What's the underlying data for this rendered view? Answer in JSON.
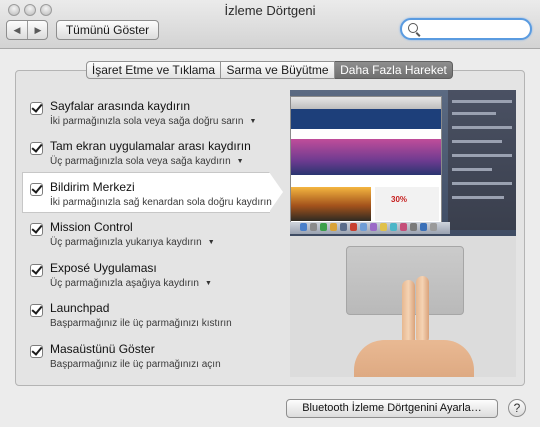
{
  "window": {
    "title": "İzleme Dörtgeni"
  },
  "toolbar": {
    "back_icon": "chevron-left-icon",
    "forward_icon": "chevron-right-icon",
    "show_all_label": "Tümünü Göster",
    "search_value": "",
    "search_icon": "search-icon"
  },
  "tabs": [
    {
      "label": "İşaret Etme ve Tıklama",
      "selected": false
    },
    {
      "label": "Sarma ve Büyütme",
      "selected": false
    },
    {
      "label": "Daha Fazla Hareket",
      "selected": true
    }
  ],
  "gestures": [
    {
      "title": "Sayfalar arasında kaydırın",
      "subtitle": "İki parmağınızla sola veya sağa doğru sarın",
      "has_dropdown": true,
      "checked": true,
      "selected": false
    },
    {
      "title": "Tam ekran uygulamalar arası kaydırın",
      "subtitle": "Üç parmağınızla sola veya sağa kaydırın",
      "has_dropdown": true,
      "checked": true,
      "selected": false
    },
    {
      "title": "Bildirim Merkezi",
      "subtitle": "İki parmağınızla sağ kenardan sola doğru kaydırın",
      "has_dropdown": false,
      "checked": true,
      "selected": true
    },
    {
      "title": "Mission Control",
      "subtitle": "Üç parmağınızla yukarıya kaydırın",
      "has_dropdown": true,
      "checked": true,
      "selected": false
    },
    {
      "title": "Exposé Uygulaması",
      "subtitle": "Üç parmağınızla aşağıya kaydırın",
      "has_dropdown": true,
      "checked": true,
      "selected": false
    },
    {
      "title": "Launchpad",
      "subtitle": "Başparmağınız ile üç parmağınızı kıstırın",
      "has_dropdown": false,
      "checked": true,
      "selected": false
    },
    {
      "title": "Masaüstünü Göster",
      "subtitle": "Başparmağınız ile üç parmağınızı açın",
      "has_dropdown": false,
      "checked": true,
      "selected": false
    }
  ],
  "preview": {
    "sale_text": "30%"
  },
  "footer": {
    "bluetooth_button": "Bluetooth İzleme Dörtgenini Ayarla…",
    "help_label": "?"
  }
}
